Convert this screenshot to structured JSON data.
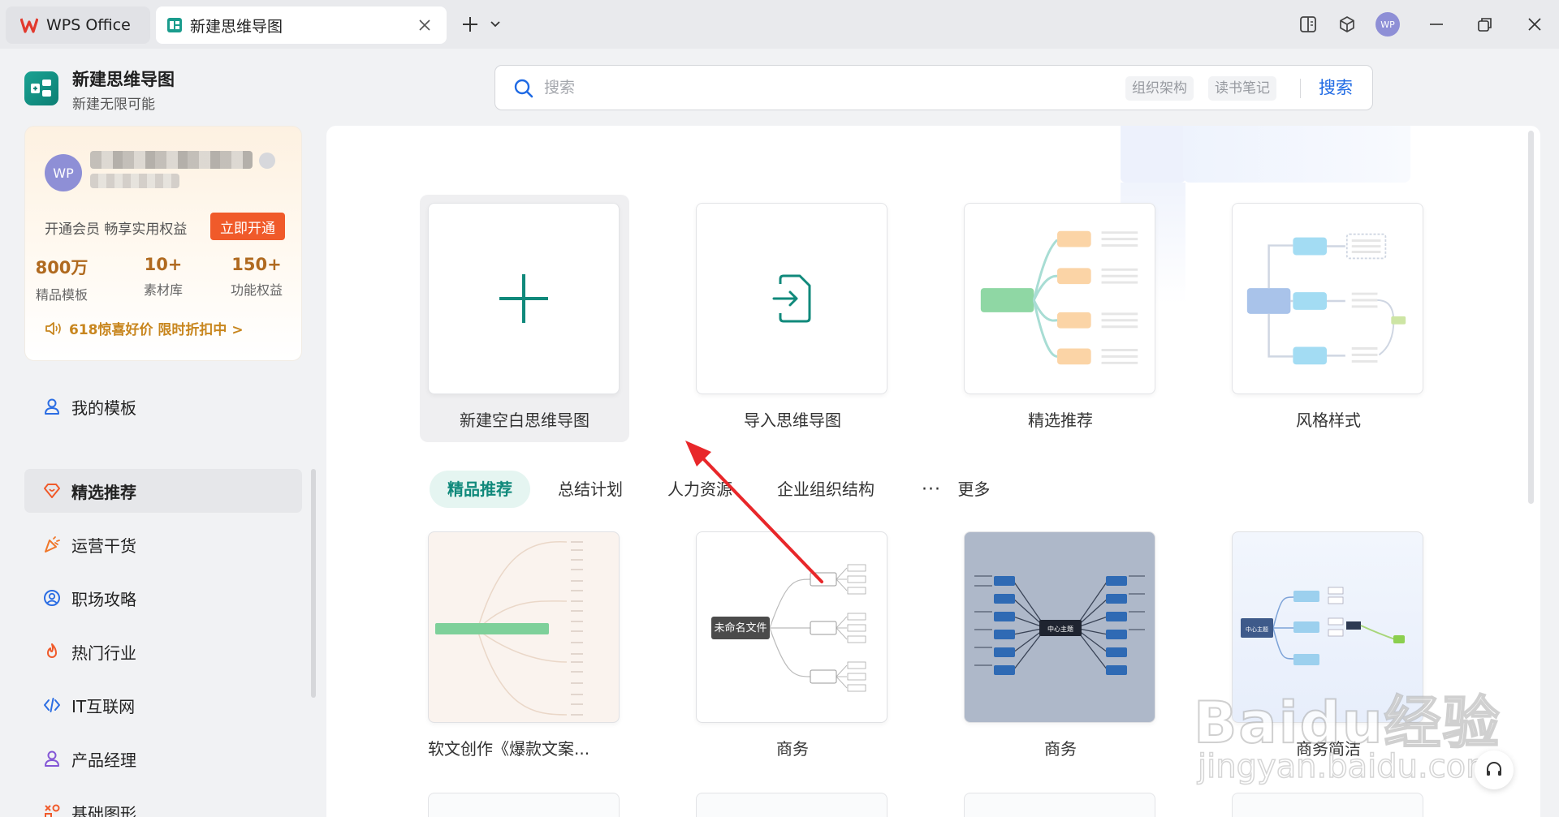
{
  "titlebar": {
    "tabs": [
      {
        "label": "WPS Office"
      },
      {
        "label": "新建思维导图"
      }
    ],
    "avatar_text": "WP"
  },
  "app": {
    "title": "新建思维导图",
    "subtitle": "新建无限可能"
  },
  "search": {
    "placeholder": "搜索",
    "tags": [
      "组织架构",
      "读书笔记"
    ],
    "button": "搜索"
  },
  "member": {
    "avatar": "WP",
    "promo": "开通会员 畅享实用权益",
    "open_button": "立即开通",
    "stats": [
      {
        "value": "800万",
        "label": "精品模板"
      },
      {
        "value": "10+",
        "label": "素材库"
      },
      {
        "value": "150+",
        "label": "功能权益"
      }
    ],
    "sale": "618惊喜好价 限时折扣中 >"
  },
  "sidebar": {
    "items": [
      {
        "label": "我的模板",
        "icon": "user-icon"
      },
      {
        "label": "精选推荐",
        "icon": "diamond-heart-icon"
      },
      {
        "label": "运营干货",
        "icon": "party-icon"
      },
      {
        "label": "职场攻略",
        "icon": "user-circle-icon"
      },
      {
        "label": "热门行业",
        "icon": "flame-icon"
      },
      {
        "label": "IT互联网",
        "icon": "code-icon"
      },
      {
        "label": "产品经理",
        "icon": "person-icon"
      },
      {
        "label": "基础图形",
        "icon": "shapes-icon"
      }
    ]
  },
  "actions": [
    {
      "label": "新建空白思维导图"
    },
    {
      "label": "导入思维导图"
    },
    {
      "label": "精选推荐"
    },
    {
      "label": "风格样式"
    }
  ],
  "categories": [
    {
      "label": "精品推荐"
    },
    {
      "label": "总结计划"
    },
    {
      "label": "人力资源"
    },
    {
      "label": "企业组织结构"
    },
    {
      "label": "更多"
    }
  ],
  "templates": [
    {
      "label": "软文创作《爆款文案...",
      "thumb_text": ""
    },
    {
      "label": "商务",
      "thumb_text": "未命名文件"
    },
    {
      "label": "商务",
      "thumb_text": "中心主题"
    },
    {
      "label": "商务简洁",
      "thumb_text": "中心主题"
    }
  ],
  "watermark": {
    "brand": "Baidu经验",
    "url": "jingyan.baidu.com"
  },
  "colors": {
    "accent": "#10897b",
    "search_link": "#1f6ae4",
    "open_button": "#f05a2a",
    "member_gold": "#b06a20"
  }
}
